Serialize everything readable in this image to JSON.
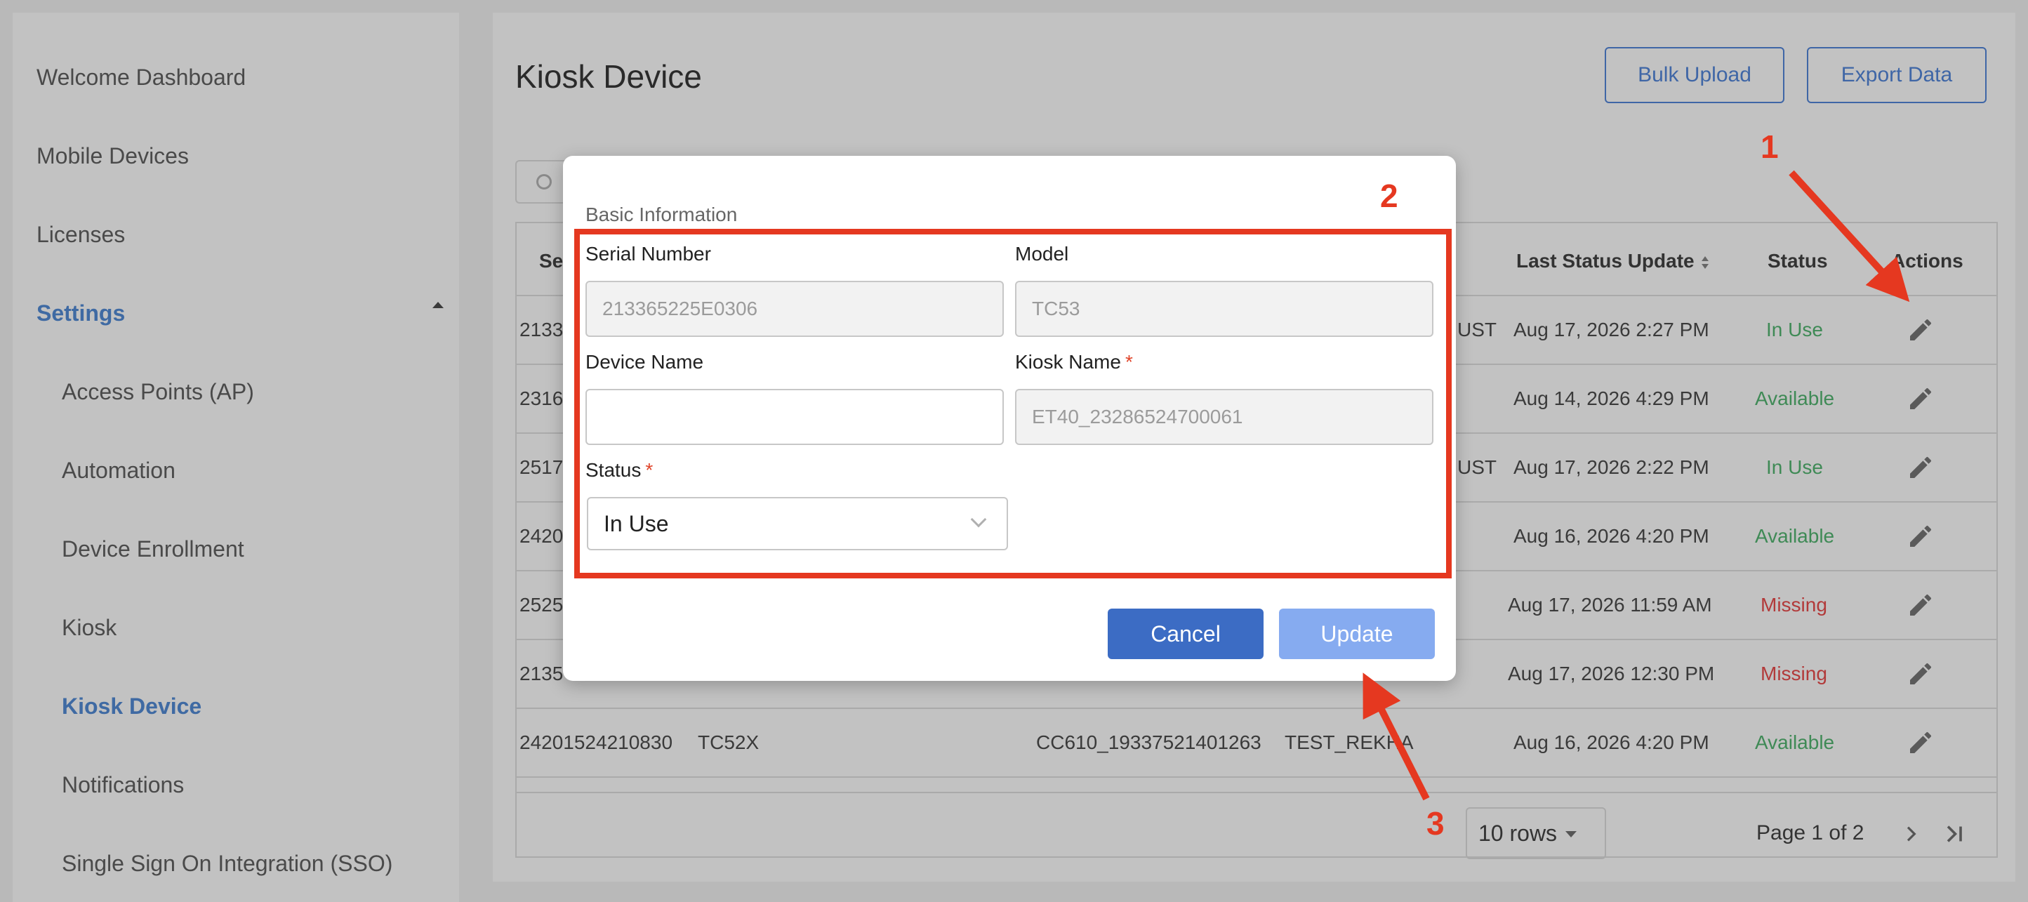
{
  "sidebar": {
    "items": [
      {
        "label": "Welcome Dashboard"
      },
      {
        "label": "Mobile Devices"
      },
      {
        "label": "Licenses"
      },
      {
        "label": "Settings"
      },
      {
        "label": "Access Points (AP)"
      },
      {
        "label": "Automation"
      },
      {
        "label": "Device Enrollment"
      },
      {
        "label": "Kiosk"
      },
      {
        "label": "Kiosk Device"
      },
      {
        "label": "Notifications"
      },
      {
        "label": "Single Sign On Integration (SSO)"
      }
    ]
  },
  "header": {
    "title": "Kiosk Device",
    "bulk_upload_label": "Bulk Upload",
    "export_label": "Export Data"
  },
  "table": {
    "columns": {
      "serial_partial": "Se",
      "last_status_update": "Last Status Update",
      "status": "Status",
      "actions": "Actions"
    },
    "rows": [
      {
        "serial": "2133",
        "extra": "UST",
        "last_update": "Aug 17, 2026 2:27 PM",
        "status": "In Use",
        "status_kind": "inuse"
      },
      {
        "serial": "2316",
        "extra": "",
        "last_update": "Aug 14, 2026 4:29 PM",
        "status": "Available",
        "status_kind": "available"
      },
      {
        "serial": "2517",
        "extra": "UST",
        "last_update": "Aug 17, 2026 2:22 PM",
        "status": "In Use",
        "status_kind": "inuse"
      },
      {
        "serial": "2420",
        "extra": "",
        "last_update": "Aug 16, 2026 4:20 PM",
        "status": "Available",
        "status_kind": "available"
      },
      {
        "serial": "2525",
        "extra": "",
        "last_update": "Aug 17, 2026 11:59 AM",
        "status": "Missing",
        "status_kind": "missing"
      },
      {
        "serial": "2135",
        "extra": "",
        "last_update": "Aug 17, 2026 12:30 PM",
        "status": "Missing",
        "status_kind": "missing"
      },
      {
        "serial": "24201524210830",
        "model": "TC52X",
        "kiosk": "CC610_19337521401263",
        "extra": "TEST_REKHA",
        "last_update": "Aug 16, 2026 4:20 PM",
        "status": "Available",
        "status_kind": "available"
      }
    ],
    "rows_per_page": "10 rows",
    "page_info": "Page 1 of 2"
  },
  "modal": {
    "section": "Basic Information",
    "serial_label": "Serial Number",
    "serial_value": "213365225E0306",
    "model_label": "Model",
    "model_value": "TC53",
    "device_name_label": "Device Name",
    "device_name_value": "",
    "kiosk_name_label": "Kiosk Name",
    "kiosk_name_value": "ET40_23286524700061",
    "status_label": "Status",
    "status_value": "In Use",
    "required_mark": "*",
    "cancel_label": "Cancel",
    "update_label": "Update"
  },
  "annotations": {
    "n1": "1",
    "n2": "2",
    "n3": "3",
    "color": "#e53820"
  },
  "colors": {
    "accent": "#3f66a6",
    "available": "#3f8a56",
    "missing": "#b23a3a",
    "update_disabled": "#86abf0"
  }
}
